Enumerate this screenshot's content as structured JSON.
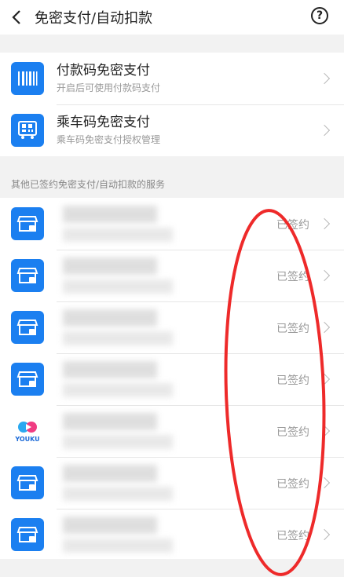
{
  "header": {
    "title": "免密支付/自动扣款",
    "help_symbol": "?"
  },
  "quick_items": [
    {
      "title": "付款码免密支付",
      "subtitle": "开启后可使用付款码支付",
      "icon": "barcode-icon"
    },
    {
      "title": "乘车码免密支付",
      "subtitle": "乘车码免密支付授权管理",
      "icon": "bus-qr-icon"
    }
  ],
  "section_label": "其他已签约免密支付/自动扣款的服务",
  "services": [
    {
      "icon": "store-icon",
      "status": "已签约"
    },
    {
      "icon": "store-icon",
      "status": "已签约"
    },
    {
      "icon": "store-icon",
      "status": "已签约"
    },
    {
      "icon": "store-icon",
      "status": "已签约"
    },
    {
      "icon": "youku-logo",
      "logo_text": "YOUKU",
      "status": "已签约"
    },
    {
      "icon": "store-icon",
      "status": "已签约"
    },
    {
      "icon": "store-icon",
      "status": "已签约"
    }
  ],
  "colors": {
    "accent": "#1b7ff0",
    "annotation": "#ee2a2a"
  }
}
